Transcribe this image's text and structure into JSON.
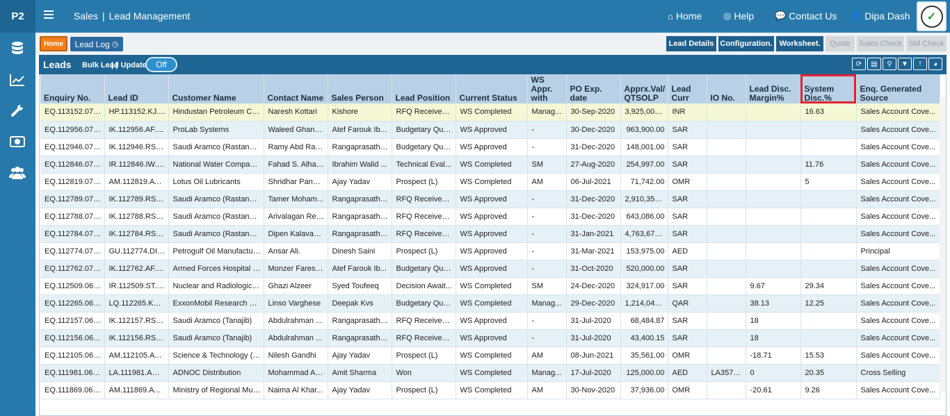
{
  "app": {
    "logo": "P2",
    "module": "Sales",
    "separator": "|",
    "page": "Lead Management"
  },
  "topnav": {
    "home": "Home",
    "help": "Help",
    "contact": "Contact Us",
    "user": "Dipa Dash"
  },
  "tabs": {
    "home": "Home",
    "lead_log": "Lead Log",
    "right": [
      {
        "label": "Lead Details",
        "enabled": true
      },
      {
        "label": "Configuration.",
        "enabled": true
      },
      {
        "label": "Worksheet.",
        "enabled": true
      },
      {
        "label": "Quote",
        "enabled": false
      },
      {
        "label": "Sales Check",
        "enabled": false
      },
      {
        "label": "SM Check",
        "enabled": false
      }
    ]
  },
  "panel": {
    "title": "Leads",
    "separator": "| |",
    "bulk_label": "Bulk Lead Update",
    "toggle": "Off"
  },
  "table": {
    "columns": [
      "Enquiry No.",
      "Lead ID",
      "Customer Name",
      "Contact Name",
      "Sales Person",
      "Lead Position",
      "Current Status",
      "WS Appr. with",
      "PO Exp. date",
      "Apprx.Val/ QTSOLP",
      "Lead Curr",
      "IO No.",
      "Lead Disc. Margin%",
      "System Disc.%",
      "Enq. Generated Source"
    ],
    "rows": [
      [
        "EQ.113152.0720",
        "HP.113152.KJ....",
        "Hindustan Petroleum Co...",
        "Naresh Kottari",
        "Kishore",
        "RFQ Received ...",
        "WS Completed",
        "Manag...",
        "30-Sep-2020",
        "3,925,000....",
        "INR",
        "",
        "",
        "16.63",
        "Sales Account Cove..."
      ],
      [
        "EQ.112956.0720",
        "IK.112956.AF.0...",
        "ProLab Systems",
        "Waleed Ghane...",
        "Atef Farouk Ib...",
        "Budgetary Quo...",
        "WS Approved",
        "-",
        "30-Dec-2020",
        "963,900.00",
        "SAR",
        "",
        "",
        "",
        "Sales Account Cove..."
      ],
      [
        "EQ.112946.0720",
        "IK.112946.RS.0...",
        "Saudi Aramco (Rastanura)",
        "Ramy Abd Rab...",
        "Rangaprasath ...",
        "Budgetary Quo...",
        "WS Approved",
        "-",
        "31-Dec-2020",
        "148,001.00",
        "SAR",
        "",
        "",
        "",
        "Sales Account Cove..."
      ],
      [
        "EQ.112846.0720",
        "IR.112846.IW.0...",
        "National Water Compan...",
        "Fahad S. Alhaq...",
        "Ibrahim Walid ...",
        "Technical Eval...",
        "WS Completed",
        "SM",
        "27-Aug-2020",
        "254,997.00",
        "SAR",
        "",
        "",
        "11.76",
        "Sales Account Cove..."
      ],
      [
        "EQ.112819.0720",
        "AM.112819.AY....",
        "Lotus Oil Lubricants",
        "Shridhar Pandav",
        "Ajay Yadav",
        "Prospect (L)",
        "WS Completed",
        "AM",
        "06-Jul-2021",
        "71,742.00",
        "OMR",
        "",
        "",
        "5",
        "Sales Account Cove..."
      ],
      [
        "EQ.112789.0720",
        "IK.112789.RS.0...",
        "Saudi Aramco (Rastanura)",
        "Tamer Moham...",
        "Rangaprasath ...",
        "RFQ Received ...",
        "WS Approved",
        "-",
        "31-Dec-2020",
        "2,910,352....",
        "SAR",
        "",
        "",
        "",
        "Sales Account Cove..."
      ],
      [
        "EQ.112788.0720",
        "IK.112788.RS.0...",
        "Saudi Aramco (Rastanura)",
        "Arivalagan Ren...",
        "Rangaprasath ...",
        "RFQ Received ...",
        "WS Approved",
        "-",
        "31-Dec-2020",
        "643,086.00",
        "SAR",
        "",
        "",
        "",
        "Sales Account Cove..."
      ],
      [
        "EQ.112784.0720",
        "IK.112784.RS.0...",
        "Saudi Aramco (Rastanura)",
        "Dipen Kalavadi...",
        "Rangaprasath ...",
        "RFQ Received ...",
        "WS Approved",
        "-",
        "31-Jan-2021",
        "4,763,677....",
        "SAR",
        "",
        "",
        "",
        "Sales Account Cove..."
      ],
      [
        "EQ.112774.0720",
        "GU.112774.DI....",
        "Petrogulf Oil Manufactur...",
        "Ansar Ali.",
        "Dinesh Saini",
        "Prospect (L)",
        "WS Approved",
        "-",
        "31-Mar-2021",
        "153,975.00",
        "AED",
        "",
        "",
        "",
        "Principal"
      ],
      [
        "EQ.112762.0720",
        "IK.112762.AF.0...",
        "Armed Forces Hospital (...",
        "Monzer Fares A...",
        "Atef Farouk Ib...",
        "Budgetary Quo...",
        "WS Approved",
        "-",
        "31-Oct-2020",
        "520,000.00",
        "SAR",
        "",
        "",
        "",
        "Sales Account Cove..."
      ],
      [
        "EQ.112509.0620",
        "IR.112509.ST.0...",
        "Nuclear and Radiologica...",
        "Ghazi Alzeer",
        "Syed Toufeeq",
        "Decision Await...",
        "WS Completed",
        "SM",
        "24-Dec-2020",
        "324,917.00",
        "SAR",
        "",
        "9.67",
        "29.34",
        "Sales Account Cove..."
      ],
      [
        "EQ.112265.0620",
        "LQ.112265.KV....",
        "ExxonMobil Research Qa...",
        "Linso Varghese",
        "Deepak Kvs",
        "Budgetary Quo...",
        "WS Completed",
        "Manag...",
        "29-Dec-2020",
        "1,214,041....",
        "QAR",
        "",
        "38.13",
        "12.25",
        "Sales Account Cove..."
      ],
      [
        "EQ.112157.0620",
        "IK.112157.RS.0...",
        "Saudi Aramco (Tanajib)",
        "Abdulrahman ...",
        "Rangaprasath ...",
        "RFQ Received ...",
        "WS Approved",
        "-",
        "31-Jul-2020",
        "68,484.87",
        "SAR",
        "",
        "18",
        "",
        "Sales Account Cove..."
      ],
      [
        "EQ.112156.0620",
        "IK.112156.RS.0...",
        "Saudi Aramco (Tanajib)",
        "Abdulrahman ...",
        "Rangaprasath ...",
        "RFQ Received ...",
        "WS Approved",
        "-",
        "31-Jul-2020",
        "43,400.15",
        "SAR",
        "",
        "18",
        "",
        "Sales Account Cove..."
      ],
      [
        "EQ.112105.0620",
        "AM.112105.AY....",
        "Science & Technology (S...",
        "Nilesh Gandhi",
        "Ajay Yadav",
        "Prospect (L)",
        "WS Completed",
        "AM",
        "08-Jun-2021",
        "35,561.00",
        "OMR",
        "",
        "-18.71",
        "15.53",
        "Sales Account Cove..."
      ],
      [
        "EQ.111981.0620",
        "LA.111981.AM....",
        "ADNOC Distribution",
        "Mohammad As...",
        "Amit Sharma",
        "Won",
        "WS Completed",
        "Manag...",
        "17-Jul-2020",
        "125,000.00",
        "AED",
        "LA3574...",
        "0",
        "20.35",
        "Cross Selling"
      ],
      [
        "EQ.111869.0620",
        "AM.111869.AY....",
        "Ministry of Regional Mun...",
        "Naima Al Khar...",
        "Ajay Yadav",
        "Prospect (L)",
        "WS Completed",
        "AM",
        "30-Nov-2020",
        "37,936.00",
        "OMR",
        "",
        "-20.61",
        "9.26",
        "Sales Account Cove..."
      ]
    ]
  },
  "colors": {
    "header_blue": "#2779ab",
    "panel_blue": "#1f6594",
    "home_orange": "#f07f1c",
    "highlight_red": "#e0232f",
    "selected_row": "#f4f8d5"
  }
}
